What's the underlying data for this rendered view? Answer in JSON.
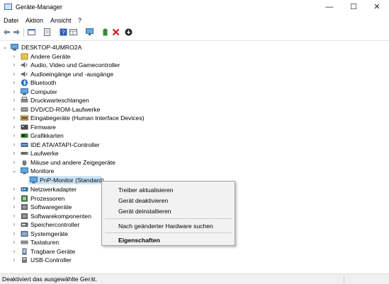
{
  "window": {
    "title": "Geräte-Manager",
    "minimize_glyph": "—",
    "maximize_glyph": "☐",
    "close_glyph": "✕"
  },
  "menubar": {
    "items": [
      "Datei",
      "Aktion",
      "Ansicht",
      "?"
    ]
  },
  "toolbar": {
    "icons": [
      "back-icon",
      "forward-icon",
      "properties-icon",
      "show-hidden-icon",
      "help-icon",
      "view-icon",
      "monitor-scan-icon",
      "update-driver-icon",
      "uninstall-icon",
      "download-icon"
    ]
  },
  "tree": {
    "root": "DESKTOP-4UMRO2A",
    "items": [
      {
        "label": "Andere Geräte",
        "icon": "unknown-device-icon"
      },
      {
        "label": "Audio, Video und Gamecontroller",
        "icon": "speaker-icon"
      },
      {
        "label": "Audioeingänge und -ausgänge",
        "icon": "speaker-icon"
      },
      {
        "label": "Bluetooth",
        "icon": "bluetooth-icon"
      },
      {
        "label": "Computer",
        "icon": "computer-icon"
      },
      {
        "label": "Druckwarteschlangen",
        "icon": "printer-icon"
      },
      {
        "label": "DVD/CD-ROM-Laufwerke",
        "icon": "disc-drive-icon"
      },
      {
        "label": "Eingabegeräte (Human Interface Devices)",
        "icon": "hid-icon"
      },
      {
        "label": "Firmware",
        "icon": "firmware-icon"
      },
      {
        "label": "Grafikkarten",
        "icon": "display-adapter-icon"
      },
      {
        "label": "IDE ATA/ATAPI-Controller",
        "icon": "ide-controller-icon"
      },
      {
        "label": "Laufwerke",
        "icon": "disk-drive-icon"
      },
      {
        "label": "Mäuse und andere Zeigegeräte",
        "icon": "mouse-icon"
      },
      {
        "label": "Monitore",
        "icon": "monitor-icon"
      },
      {
        "label": "PnP-Monitor (Standard)",
        "icon": "monitor-icon"
      },
      {
        "label": "Netzwerkadapter",
        "icon": "network-adapter-icon"
      },
      {
        "label": "Prozessoren",
        "icon": "processor-icon"
      },
      {
        "label": "Softwaregeräte",
        "icon": "software-device-icon"
      },
      {
        "label": "Softwarekomponenten",
        "icon": "software-component-icon"
      },
      {
        "label": "Speichercontroller",
        "icon": "storage-controller-icon"
      },
      {
        "label": "Systemgeräte",
        "icon": "system-device-icon"
      },
      {
        "label": "Tastaturen",
        "icon": "keyboard-icon"
      },
      {
        "label": "Tragbare Geräte",
        "icon": "portable-device-icon"
      },
      {
        "label": "USB-Controller",
        "icon": "usb-icon"
      }
    ]
  },
  "context_menu": {
    "update_driver": "Treiber aktualisieren",
    "disable_device": "Gerät deaktivieren",
    "uninstall_device": "Gerät deinstallieren",
    "scan_hardware": "Nach geänderter Hardware suchen",
    "properties": "Eigenschaften"
  },
  "status_bar": {
    "text": "Deaktiviert das ausgewählte Gerät."
  },
  "colors": {
    "selection": "#cce4f7",
    "accent": "#0078d7",
    "uninstall_red": "#d11a1a"
  }
}
